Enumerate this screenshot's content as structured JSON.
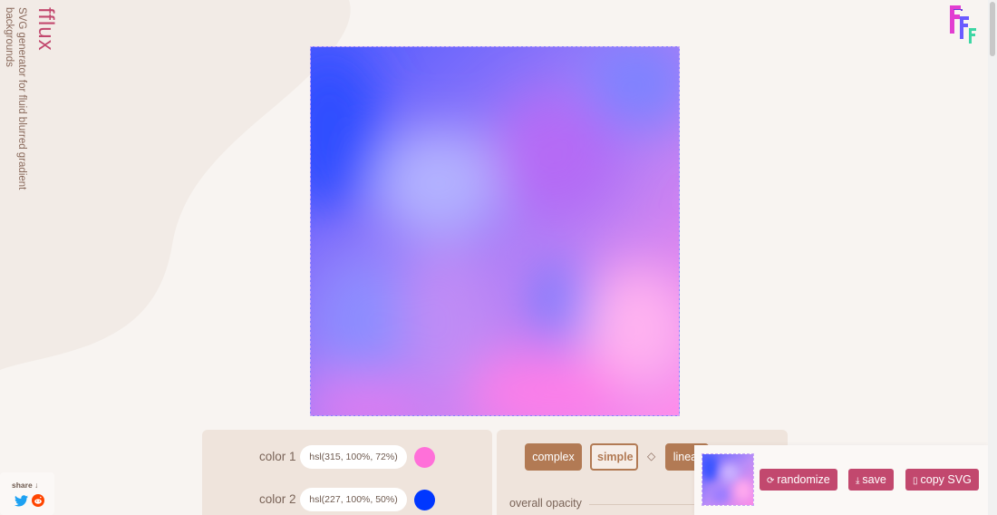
{
  "brand": {
    "name": "fflux",
    "tagline_line1": "SVG generator for fluid blurred gradient",
    "tagline_line2": "backgrounds"
  },
  "logo": {
    "icon": "fff-logo-icon",
    "colors": [
      "#e23dd1",
      "#4b5bff",
      "#3dd6a4"
    ]
  },
  "colors": [
    {
      "label": "color 1",
      "value": "hsl(315, 100%, 72%)",
      "swatch": "#ff70d9"
    },
    {
      "label": "color 2",
      "value": "hsl(227, 100%, 50%)",
      "swatch": "#0037ff"
    }
  ],
  "modes": {
    "complex": "complex",
    "simple": "simple",
    "linear": "linear",
    "separator_icon": "diamond-icon"
  },
  "opacity": {
    "label": "overall opacity"
  },
  "share": {
    "label": "share ↓",
    "icons": [
      "twitter-icon",
      "reddit-icon"
    ]
  },
  "actions": {
    "randomize": "randomize",
    "save": "save",
    "copy": "copy SVG"
  }
}
